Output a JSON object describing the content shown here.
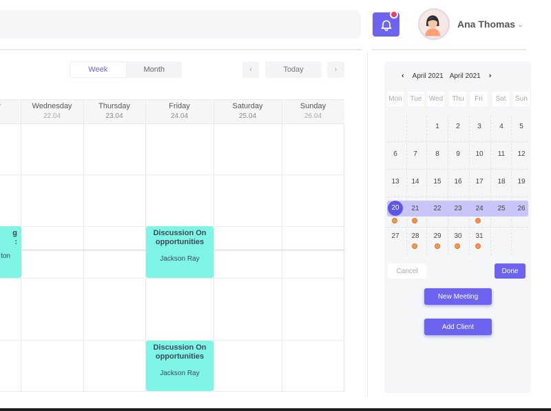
{
  "header": {
    "user_name": "Ana Thomas",
    "user_chevron": "⌄",
    "notification_icon": "bell-icon",
    "accent_color": "#6c63f0",
    "badge_color": "#ee3f6a"
  },
  "toolbar": {
    "views": [
      "Week",
      "Month"
    ],
    "active_view": "Week",
    "prev": "‹",
    "today": "Today",
    "next": "›"
  },
  "week": {
    "partial_first_day": "y",
    "days": [
      {
        "name": "Wednesday",
        "date": "22.04"
      },
      {
        "name": "Thursday",
        "date": "23.04"
      },
      {
        "name": "Friday",
        "date": "24.04"
      },
      {
        "name": "Saturday",
        "date": "25.04"
      },
      {
        "name": "Sunday",
        "date": "26.04"
      }
    ]
  },
  "events": {
    "left_partial": {
      "title_line1": "g",
      "title_line2": ":",
      "person": "ton"
    },
    "friday_1": {
      "title": "Discussion On opportunities",
      "person": "Jackson Ray"
    },
    "friday_2": {
      "title": "Discussion On opportunities",
      "person": "Jackson Ray"
    },
    "event_color": "#7ff5e5"
  },
  "mini_calendar": {
    "prev_arrow": "‹",
    "month_a": "April 2021",
    "month_b": "April 2021",
    "next_arrow": "›",
    "weekdays": [
      "Mon",
      "Tue",
      "Wed",
      "Thu",
      "Fri",
      "Sat",
      "Sun"
    ],
    "weeks": [
      [
        "",
        "",
        "1",
        "2",
        "3",
        "4",
        "5"
      ],
      [
        "6",
        "7",
        "8",
        "9",
        "10",
        "11",
        "12"
      ],
      [
        "13",
        "14",
        "15",
        "16",
        "17",
        "18",
        "19"
      ],
      [
        "20",
        "21",
        "22",
        "23",
        "24",
        "25",
        "26"
      ],
      [
        "27",
        "28",
        "29",
        "30",
        "31",
        "",
        ""
      ]
    ],
    "selected_day": "20",
    "cancel": "Cancel",
    "done": "Done"
  },
  "actions": {
    "new_meeting": "New Meeting",
    "add_client": "Add Client"
  }
}
